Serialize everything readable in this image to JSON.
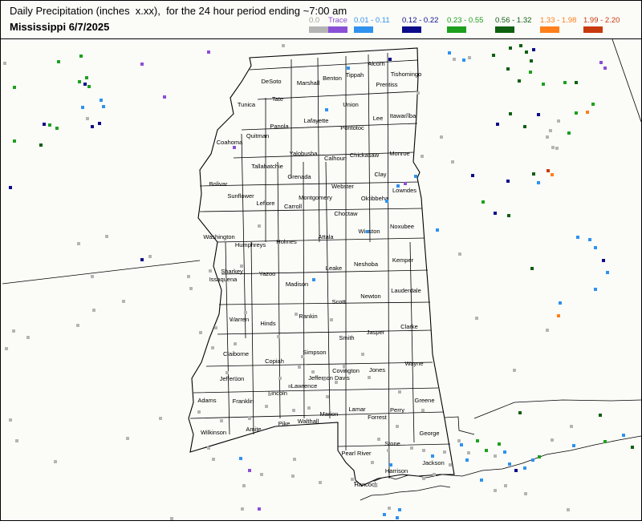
{
  "header": {
    "title_line1": "Daily Precipitation (inches  x.xx),  for the 24 hour period ending ~7:00 am",
    "title_line2": "Mississippi 6/7/2025"
  },
  "legend": [
    {
      "label": "0.0",
      "color": "#b4b4b4",
      "text_color": "#a0a0a0"
    },
    {
      "label": "Trace",
      "color": "#8a4fd6",
      "text_color": "#8a4fd6"
    },
    {
      "label": "0.01 - 0.11",
      "color": "#2f92ee",
      "text_color": "#2f92ee"
    },
    {
      "label": "0.12 - 0.22",
      "color": "#0c0c8a",
      "text_color": "#0c0c8a"
    },
    {
      "label": "0.23 - 0.55",
      "color": "#1ea01e",
      "text_color": "#1ea01e"
    },
    {
      "label": "0.56 - 1.32",
      "color": "#0f6010",
      "text_color": "#0f6010"
    },
    {
      "label": "1.33 - 1.98",
      "color": "#ff7f1a",
      "text_color": "#ff7f1a"
    },
    {
      "label": "1.99 - 2.20",
      "color": "#c83a0e",
      "text_color": "#c83a0e"
    }
  ],
  "counties": [
    "Alcorn",
    "Tishomingo",
    "Tippah",
    "Benton",
    "DeSoto",
    "Marshall",
    "Prentiss",
    "Tate",
    "Tunica",
    "Union",
    "Lee",
    "Itawamba",
    "Panola",
    "Lafayette",
    "Pontotoc",
    "Quitman",
    "Coahoma",
    "Tallahatchie",
    "Yalobusha",
    "Calhoun",
    "Chickasaw",
    "Monroe",
    "Clay",
    "Grenada",
    "Webster",
    "Bolivar",
    "Sunflower",
    "Leflore",
    "Carroll",
    "Montgomery",
    "Oktibbeha",
    "Lowndes",
    "Choctaw",
    "Washington",
    "Humphreys",
    "Holmes",
    "Attala",
    "Winston",
    "Noxubee",
    "Sharkey",
    "Issaquena",
    "Yazoo",
    "Leake",
    "Neshoba",
    "Kemper",
    "Madison",
    "Scott",
    "Newton",
    "Lauderdale",
    "Warren",
    "Hinds",
    "Rankin",
    "Smith",
    "Jasper",
    "Clarke",
    "Claiborne",
    "Copiah",
    "Simpson",
    "Jones",
    "Wayne",
    "Covington",
    "Jefferson Davis",
    "Jefferson",
    "Lawrence",
    "Franklin",
    "Lincoln",
    "Adams",
    "Marion",
    "Lamar",
    "Forrest",
    "Perry",
    "Greene",
    "Walthall",
    "Pike",
    "Amite",
    "Wilkinson",
    "George",
    "Pearl River",
    "Stone",
    "Harrison",
    "Jackson",
    "Hancock"
  ]
}
